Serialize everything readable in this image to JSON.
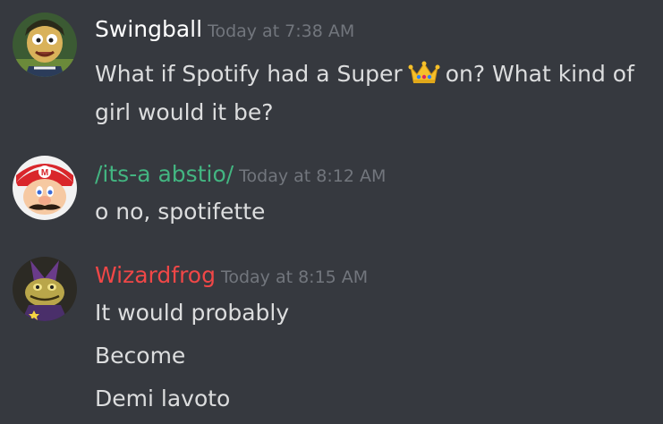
{
  "colors": {
    "background": "#36393f",
    "text": "#dcddde",
    "timestamp": "#72767d"
  },
  "messages": [
    {
      "username": "Swingball",
      "username_color": "#ffffff",
      "timestamp": "Today at 7:38 AM",
      "avatar_icon": "cartoon-boy-avatar",
      "lines": {
        "line1_before": "What if Spotify had a Super",
        "line1_emoji": "crown-emoji",
        "line1_after": "on? What kind of",
        "line2": "girl would it be?"
      }
    },
    {
      "username": "/its-a abstio/",
      "username_color": "#43b581",
      "timestamp": "Today at 8:12 AM",
      "avatar_icon": "mario-avatar",
      "lines": {
        "line1": "o no, spotifette"
      }
    },
    {
      "username": "Wizardfrog",
      "username_color": "#f04747",
      "timestamp": "Today at 8:15 AM",
      "avatar_icon": "wizard-frog-avatar",
      "lines": {
        "line1": "It would probably",
        "line2": "Become",
        "line3": "Demi lavoto"
      }
    }
  ]
}
